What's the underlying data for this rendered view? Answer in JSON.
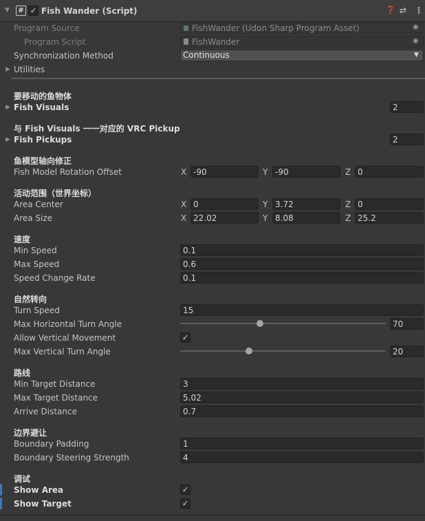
{
  "component": {
    "title": "Fish Wander (Script)",
    "enabled": true
  },
  "program_source": {
    "label": "Program Source",
    "value": "FishWander (Udon Sharp Program Asset)"
  },
  "program_script": {
    "label": "Program Script",
    "value": "FishWander"
  },
  "sync": {
    "label": "Synchronization Method",
    "value": "Continuous"
  },
  "utilities": {
    "label": "Utilities"
  },
  "sections": {
    "fish_move": "要移动的鱼物体",
    "pickup": "与 Fish Visuals 一一对应的 VRC Pickup",
    "rotation": "鱼模型轴向修正",
    "area": "活动范围（世界坐标）",
    "speed": "速度",
    "turning": "自然转向",
    "path": "路线",
    "boundary": "边界避让",
    "debug": "调试"
  },
  "fish_visuals": {
    "label": "Fish Visuals",
    "value": "2"
  },
  "fish_pickups": {
    "label": "Fish Pickups",
    "value": "2"
  },
  "rotation_offset": {
    "label": "Fish Model Rotation Offset",
    "x": "-90",
    "y": "-90",
    "z": "0"
  },
  "area_center": {
    "label": "Area Center",
    "x": "0",
    "y": "3.72",
    "z": "0"
  },
  "area_size": {
    "label": "Area Size",
    "x": "22.02",
    "y": "8.08",
    "z": "25.2"
  },
  "axes": {
    "x": "X",
    "y": "Y",
    "z": "Z"
  },
  "min_speed": {
    "label": "Min Speed",
    "value": "0.1"
  },
  "max_speed": {
    "label": "Max Speed",
    "value": "0.6"
  },
  "speed_change_rate": {
    "label": "Speed Change Rate",
    "value": "0.1"
  },
  "turn_speed": {
    "label": "Turn Speed",
    "value": "15"
  },
  "max_h_turn": {
    "label": "Max Horizontal Turn Angle",
    "value": "70",
    "fraction": 0.389
  },
  "allow_vertical": {
    "label": "Allow Vertical Movement",
    "checked": true
  },
  "max_v_turn": {
    "label": "Max Vertical Turn Angle",
    "value": "20",
    "fraction": 0.333
  },
  "min_target": {
    "label": "Min Target Distance",
    "value": "3"
  },
  "max_target": {
    "label": "Max Target Distance",
    "value": "5.02"
  },
  "arrive": {
    "label": "Arrive Distance",
    "value": "0.7"
  },
  "boundary_padding": {
    "label": "Boundary Padding",
    "value": "1"
  },
  "boundary_steering": {
    "label": "Boundary Steering Strength",
    "value": "4"
  },
  "show_area": {
    "label": "Show Area",
    "checked": true
  },
  "show_target": {
    "label": "Show Target",
    "checked": true
  },
  "icons": {
    "help": "help-icon",
    "presets": "presets-icon",
    "menu": "menu-icon",
    "script": "script-icon",
    "object_picker": "target-icon"
  }
}
